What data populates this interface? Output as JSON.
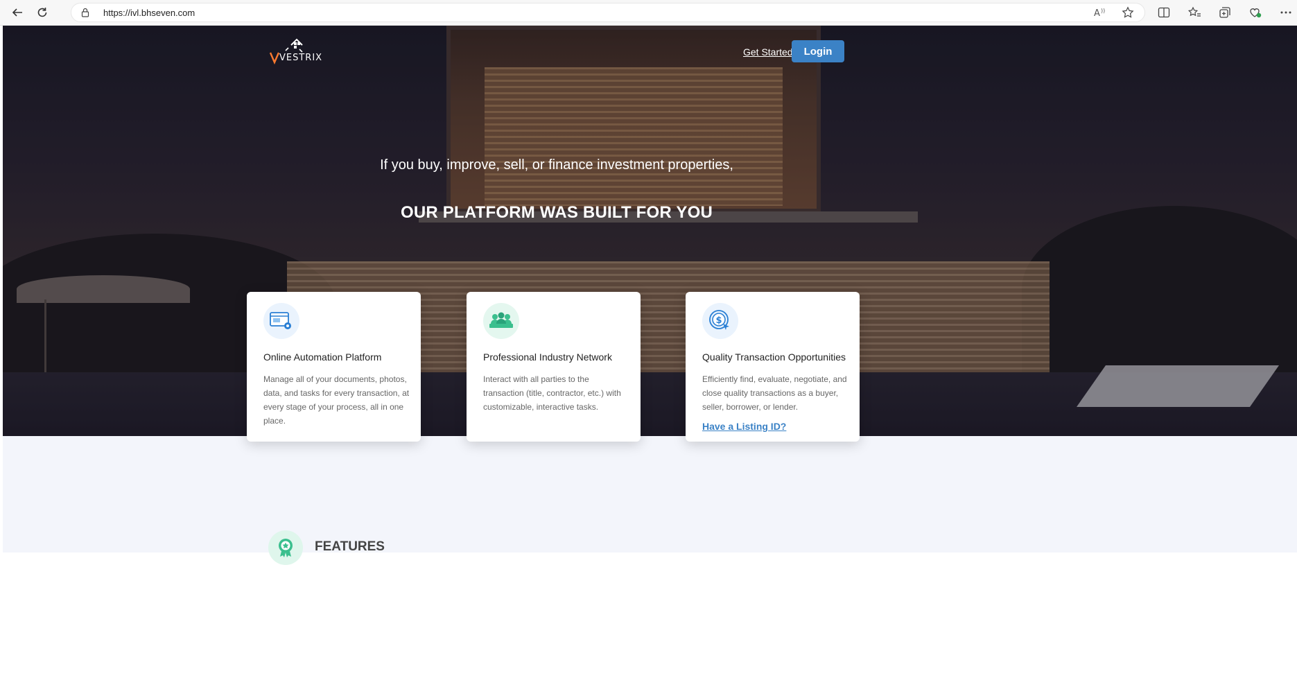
{
  "browser": {
    "url": "https://ivl.bhseven.com"
  },
  "header": {
    "logo_text": "VESTRIX",
    "get_started_label": "Get Started",
    "login_label": "Login"
  },
  "hero": {
    "subtitle": "If you buy, improve, sell, or finance investment properties,",
    "title": "OUR PLATFORM WAS BUILT FOR YOU"
  },
  "cards": [
    {
      "title": "Online Automation Platform",
      "text": "Manage all of your documents, photos, data, and tasks for every transaction, at every stage of your process, all in one place.",
      "icon": "automation-window-gear-icon"
    },
    {
      "title": "Professional Industry Network",
      "text": "Interact with all parties to the transaction (title, contractor, etc.) with customizable, interactive tasks.",
      "icon": "people-network-icon"
    },
    {
      "title": "Quality Transaction Opportunities",
      "text": "Efficiently find, evaluate, negotiate, and close quality transactions as a buyer, seller, borrower, or lender.",
      "link": "Have a Listing ID?",
      "icon": "dollar-target-cursor-icon"
    }
  ],
  "features": {
    "title": "FEATURES",
    "icon": "badge-star-icon"
  },
  "colors": {
    "accent": "#3b82c6",
    "band": "#f3f5fb"
  }
}
